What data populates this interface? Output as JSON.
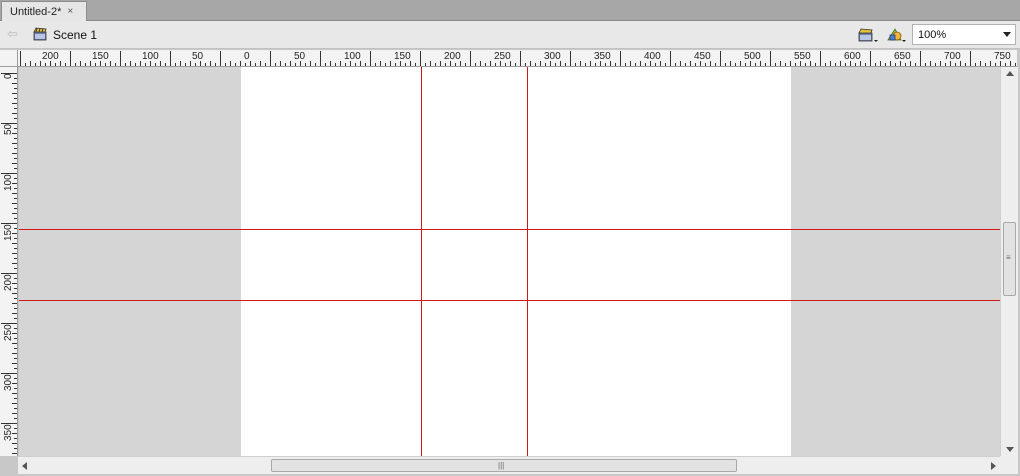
{
  "document_tab": {
    "title": "Untitled-2*",
    "close_glyph": "×"
  },
  "toolbar": {
    "back_icon": "back-arrow-icon",
    "scene_icon": "scene-clapperboard-icon",
    "scene_label": "Scene 1",
    "edit_scene_icon": "edit-scene-icon",
    "edit_symbols_icon": "edit-symbols-icon",
    "zoom_value": "100%"
  },
  "ruler_h_labels": [
    "200",
    "150",
    "100",
    "50",
    "0",
    "50",
    "100",
    "150",
    "200",
    "250",
    "300",
    "350",
    "400",
    "450",
    "500",
    "550",
    "600",
    "650",
    "700",
    "750"
  ],
  "ruler_v_labels": [
    "0",
    "50",
    "100",
    "150",
    "200",
    "250",
    "300",
    "350"
  ],
  "colors": {
    "guide": "#d01818",
    "stage": "#ffffff",
    "pasteboard": "#d5d5d5"
  }
}
